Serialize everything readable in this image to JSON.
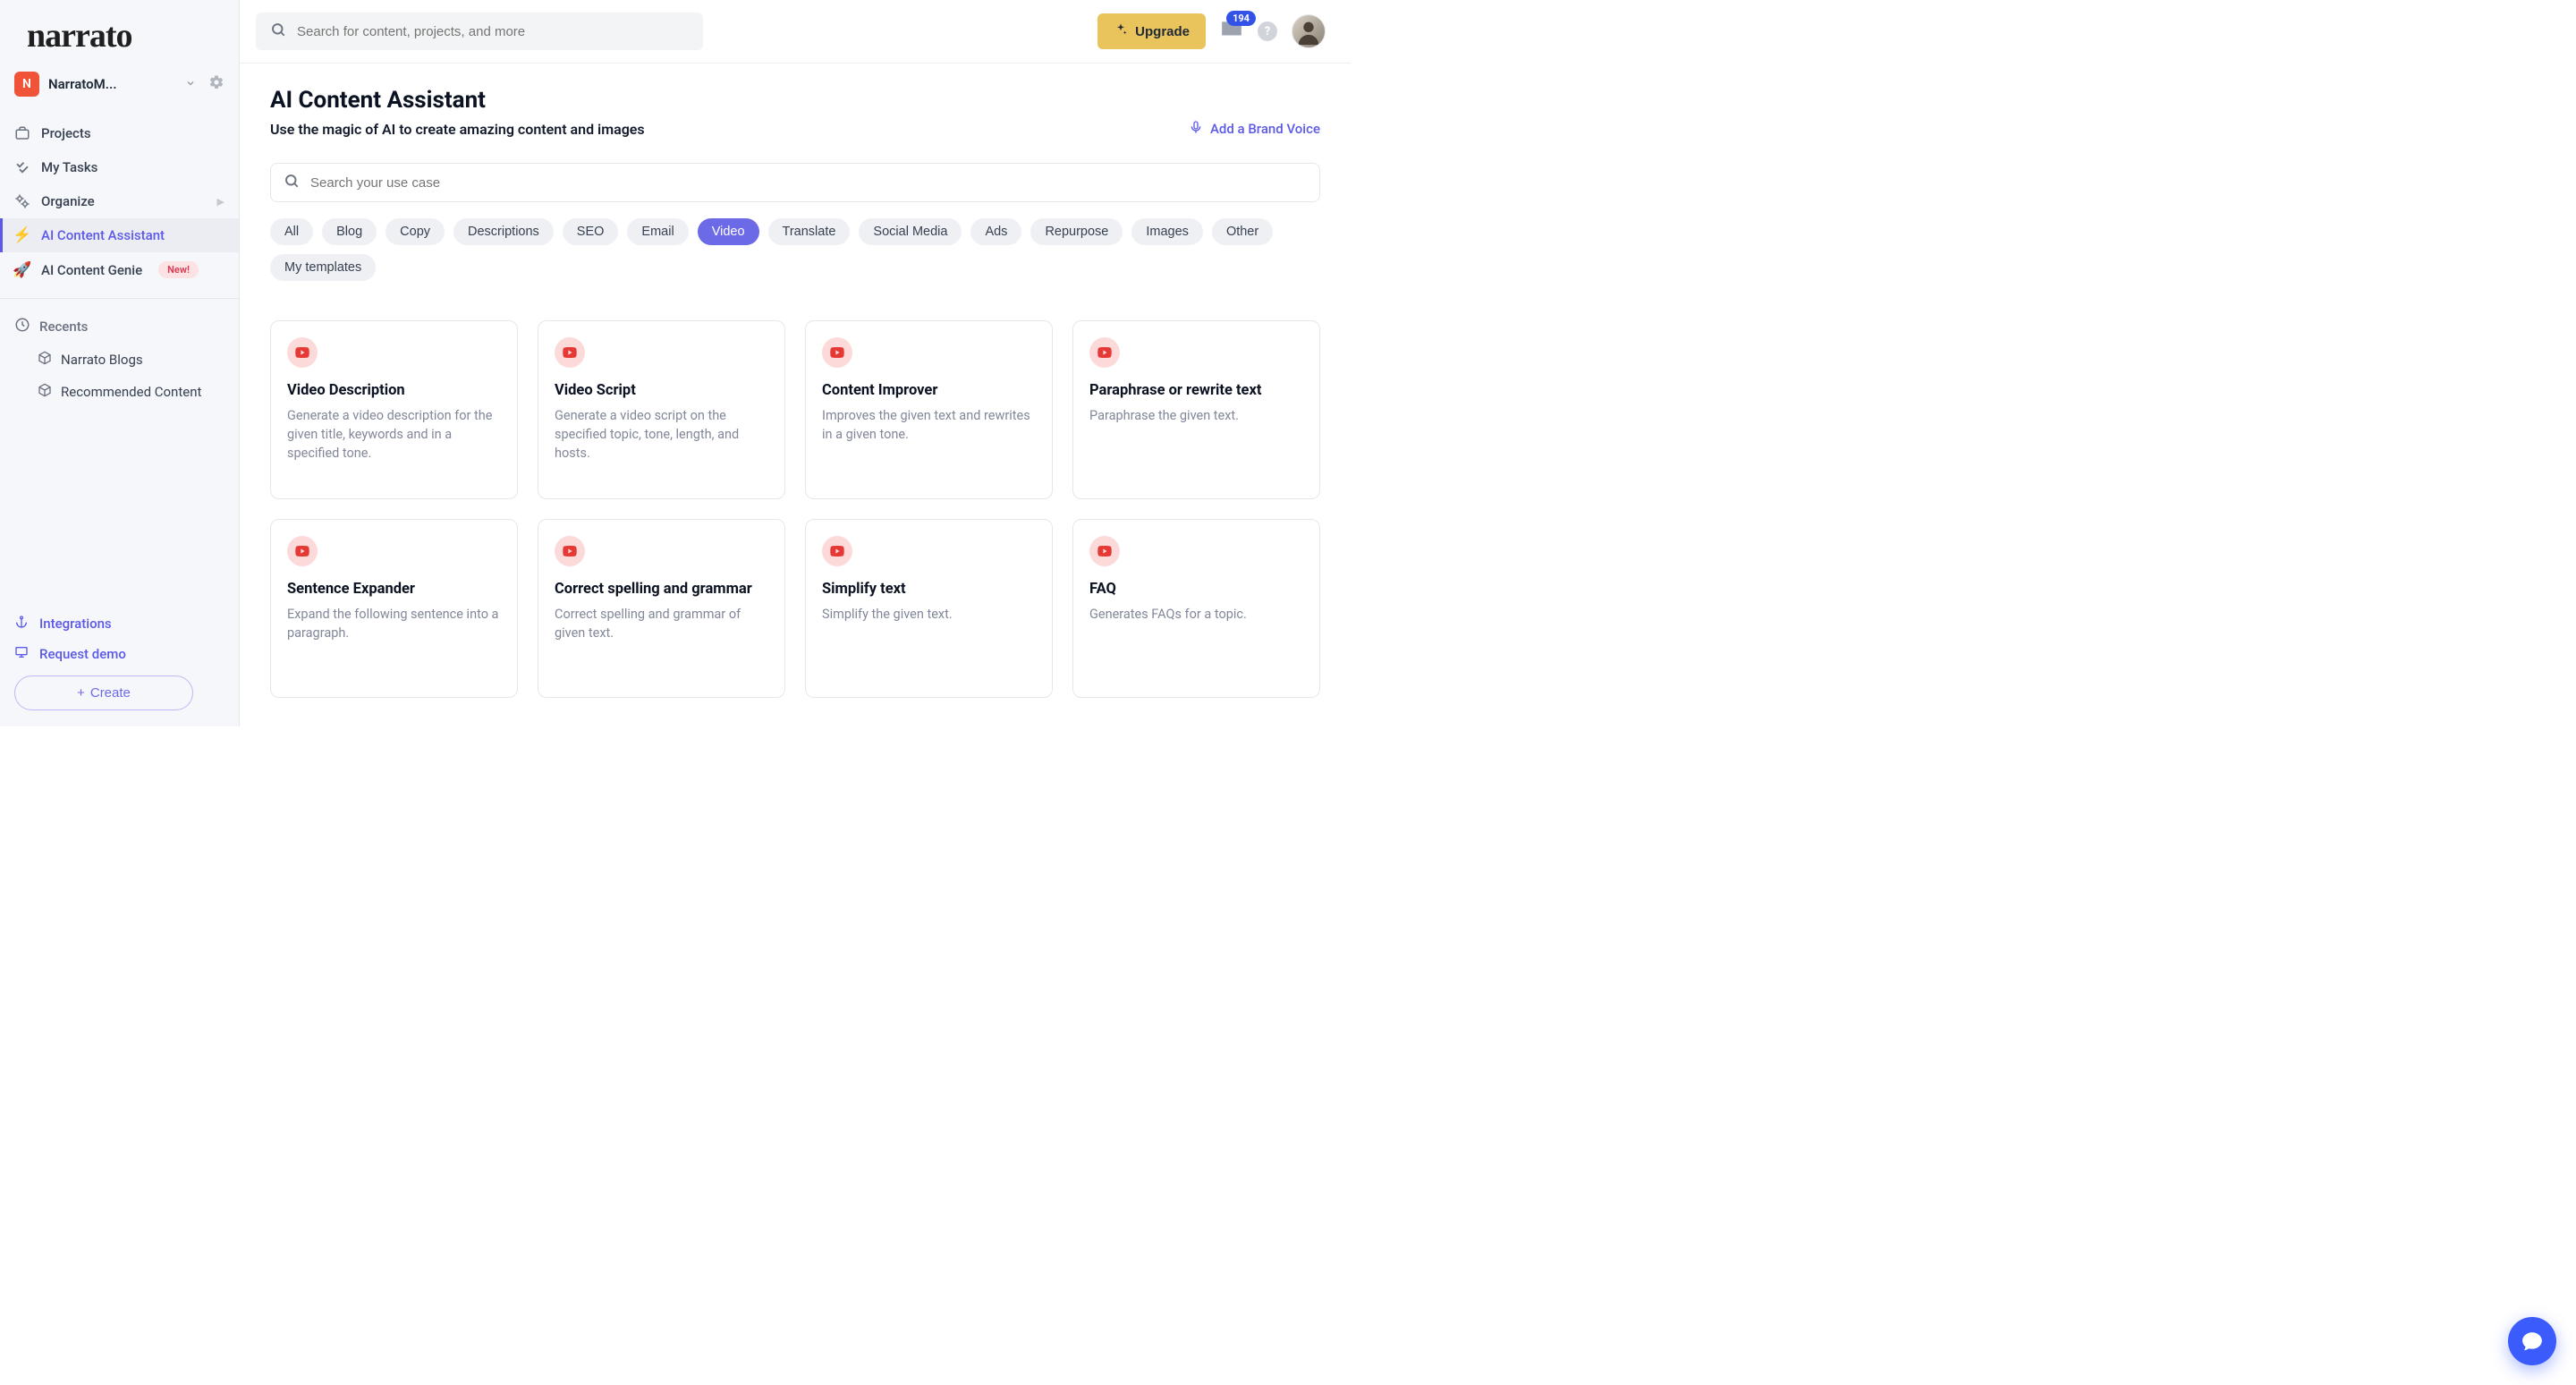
{
  "logo_text": "narrato",
  "workspace": {
    "initial": "N",
    "name": "NarratoM..."
  },
  "sidebar": {
    "items": [
      {
        "label": "Projects",
        "icon": "briefcase"
      },
      {
        "label": "My Tasks",
        "icon": "check"
      },
      {
        "label": "Organize",
        "icon": "gears",
        "caret": true
      },
      {
        "label": "AI Content Assistant",
        "icon": "bolt",
        "active": true
      },
      {
        "label": "AI Content Genie",
        "icon": "rocket",
        "badge": "New!"
      }
    ],
    "recents_label": "Recents",
    "recents": [
      {
        "label": "Narrato Blogs"
      },
      {
        "label": "Recommended Content"
      }
    ],
    "bottom": {
      "integrations": "Integrations",
      "request_demo": "Request demo",
      "create": "Create"
    }
  },
  "topbar": {
    "search_placeholder": "Search for content, projects, and more",
    "upgrade": "Upgrade",
    "notif_count": "194"
  },
  "page": {
    "title": "AI Content Assistant",
    "subtitle": "Use the magic of AI to create amazing content and images",
    "brand_voice": "Add a Brand Voice",
    "usecase_placeholder": "Search your use case"
  },
  "chips": [
    {
      "label": "All"
    },
    {
      "label": "Blog"
    },
    {
      "label": "Copy"
    },
    {
      "label": "Descriptions"
    },
    {
      "label": "SEO"
    },
    {
      "label": "Email"
    },
    {
      "label": "Video",
      "active": true
    },
    {
      "label": "Translate"
    },
    {
      "label": "Social Media"
    },
    {
      "label": "Ads"
    },
    {
      "label": "Repurpose"
    },
    {
      "label": "Images"
    },
    {
      "label": "Other"
    },
    {
      "label": "My templates"
    }
  ],
  "cards": [
    {
      "title": "Video Description",
      "desc": "Generate a video description for the given title, keywords and in a specified tone."
    },
    {
      "title": "Video Script",
      "desc": "Generate a video script on the specified topic, tone, length, and hosts."
    },
    {
      "title": "Content Improver",
      "desc": "Improves the given text and rewrites in a given tone."
    },
    {
      "title": "Paraphrase or rewrite text",
      "desc": "Paraphrase the given text."
    },
    {
      "title": "Sentence Expander",
      "desc": "Expand the following sentence into a paragraph."
    },
    {
      "title": "Correct spelling and grammar",
      "desc": "Correct spelling and grammar of given text."
    },
    {
      "title": "Simplify text",
      "desc": "Simplify the given text."
    },
    {
      "title": "FAQ",
      "desc": "Generates FAQs for a topic."
    }
  ]
}
